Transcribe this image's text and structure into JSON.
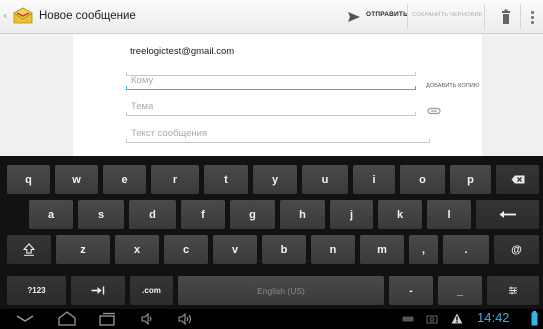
{
  "header": {
    "title": "Новое сообщение",
    "send_label": "ОТПРАВИТЬ",
    "draft_label": "СОХРАНИТЬ ЧЕРНОВИК",
    "back_glyph": "‹"
  },
  "compose": {
    "from": "treelogictest@gmail.com",
    "to_placeholder": "Кому",
    "subject_placeholder": "Тема",
    "body_placeholder": "Текст сообщения",
    "add_copy_label": "ДОБАВИТЬ КОПИЮ"
  },
  "keyboard": {
    "row1": [
      "q",
      "w",
      "e",
      "r",
      "t",
      "y",
      "u",
      "i",
      "o",
      "p"
    ],
    "row2": [
      "a",
      "s",
      "d",
      "f",
      "g",
      "h",
      "j",
      "k",
      "l"
    ],
    "row3": [
      "z",
      "x",
      "c",
      "v",
      "b",
      "n",
      "m",
      ",",
      "."
    ],
    "at": "@",
    "sym": "?123",
    "com": ".com",
    "space": "English (US)",
    "dash": "-",
    "underscore": "_"
  },
  "status": {
    "time": "14:42"
  },
  "colors": {
    "accent": "#33b5e5",
    "keyboard_bg": "#121212",
    "key_bg": "#444444"
  }
}
